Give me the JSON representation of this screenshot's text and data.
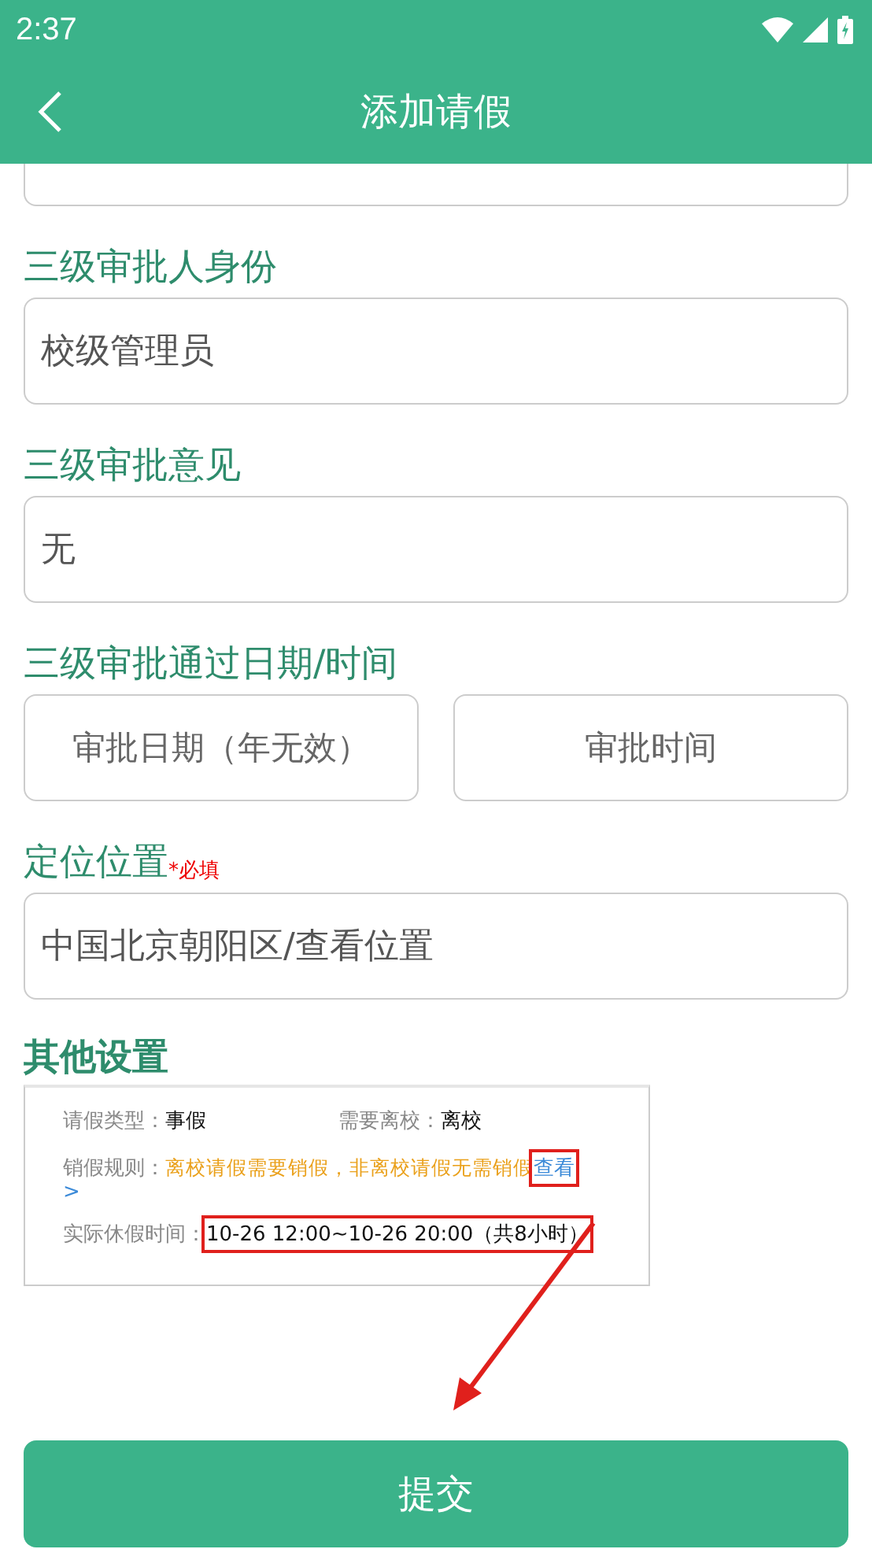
{
  "status_bar": {
    "time": "2:37"
  },
  "app_bar": {
    "title": "添加请假"
  },
  "fields": [
    {
      "label": "三级审批人身份",
      "value": "校级管理员"
    },
    {
      "label": "三级审批意见",
      "value": "无"
    }
  ],
  "date_time": {
    "label": "三级审批通过日期/时间",
    "date_placeholder": "审批日期（年无效）",
    "time_placeholder": "审批时间"
  },
  "location": {
    "label": "定位位置",
    "required_mark": "*必填",
    "value": "中国北京朝阳区/查看位置"
  },
  "other_settings": {
    "title": "其他设置",
    "screenshot": {
      "leave_type_label": "请假类型：",
      "leave_type": "事假",
      "leave_school_label": "需要离校：",
      "leave_school": "离校",
      "rule_label": "销假规则：",
      "rule": "离校请假需要销假，非离校请假无需销假",
      "rule_link": "查看",
      "rule_arrow": ">",
      "time_label": "实际休假时间：",
      "time": "10-26 12:00~10-26 20:00（共8小时）"
    }
  },
  "submit_button": "提交"
}
